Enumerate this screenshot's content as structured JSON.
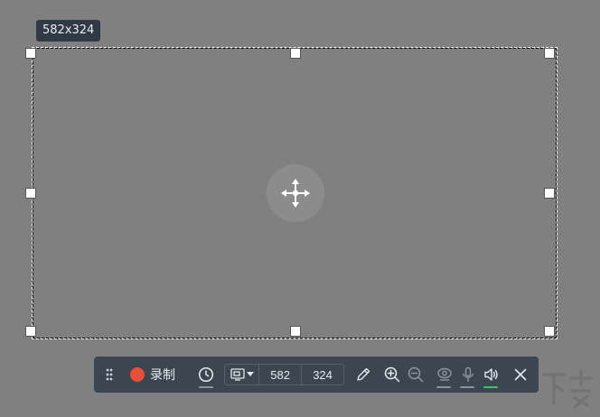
{
  "selection": {
    "size_label": "582x324"
  },
  "toolbar": {
    "record_label": "录制",
    "width_value": "582",
    "height_value": "324"
  },
  "colors": {
    "record": "#e8503a",
    "toolbar_bg": "#3c4650",
    "audio_active": "#36c46a",
    "inactive_underline": "#8a939c"
  },
  "icons": [
    "drag-grip-icon",
    "record-dot-icon",
    "clock-icon",
    "screen-select-icon",
    "pen-icon",
    "zoom-in-icon",
    "zoom-out-icon",
    "webcam-icon",
    "microphone-icon",
    "speaker-icon",
    "close-icon",
    "move-icon"
  ]
}
